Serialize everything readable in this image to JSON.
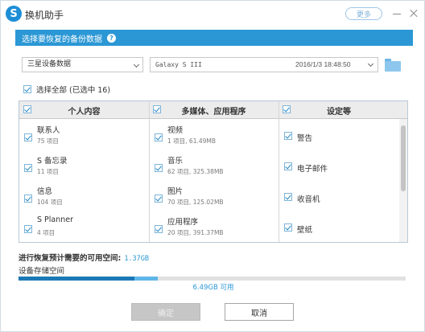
{
  "app": {
    "title": "换机助手",
    "logo_letter": "S",
    "more_label": "更多"
  },
  "section": {
    "title": "选择要恢复的备份数据",
    "help_icon": "?"
  },
  "filters": {
    "device_type": "三星设备数据",
    "backup_device": "Galaxy S III",
    "backup_date": "2016/1/3 18:48:50"
  },
  "select_all": {
    "label": "选择全部 (已选中 16)"
  },
  "table": {
    "headers": [
      "个人内容",
      "多媒体、应用程序",
      "设定等"
    ],
    "columns": [
      [
        {
          "name": "联系人",
          "sub": "75 项目"
        },
        {
          "name": "S 备忘录",
          "sub": "11 项目"
        },
        {
          "name": "信息",
          "sub": "104 项目"
        },
        {
          "name": "S Planner",
          "sub": "4 项目"
        }
      ],
      [
        {
          "name": "视频",
          "sub": "1 项目, 61.49MB"
        },
        {
          "name": "音乐",
          "sub": "62 项目, 325.38MB"
        },
        {
          "name": "图片",
          "sub": "70 项目, 125.02MB"
        },
        {
          "name": "应用程序",
          "sub": "20 项目, 391.37MB"
        }
      ],
      [
        {
          "name": "警告"
        },
        {
          "name": "电子邮件"
        },
        {
          "name": "收音机"
        },
        {
          "name": "壁纸"
        }
      ]
    ]
  },
  "storage": {
    "needed_label": "进行恢复预计需要的可用空间:",
    "needed_value": "1.37GB",
    "device_label": "设备存储空间",
    "available_text": "6.49GB 可用",
    "used_fraction": 0.3,
    "needed_fraction": 0.06,
    "used_color": "#1c79b5",
    "needed_color": "#5fb6e8"
  },
  "buttons": {
    "ok_label": "确定",
    "cancel_label": "取消"
  },
  "colors": {
    "accent": "#2b97d5"
  }
}
